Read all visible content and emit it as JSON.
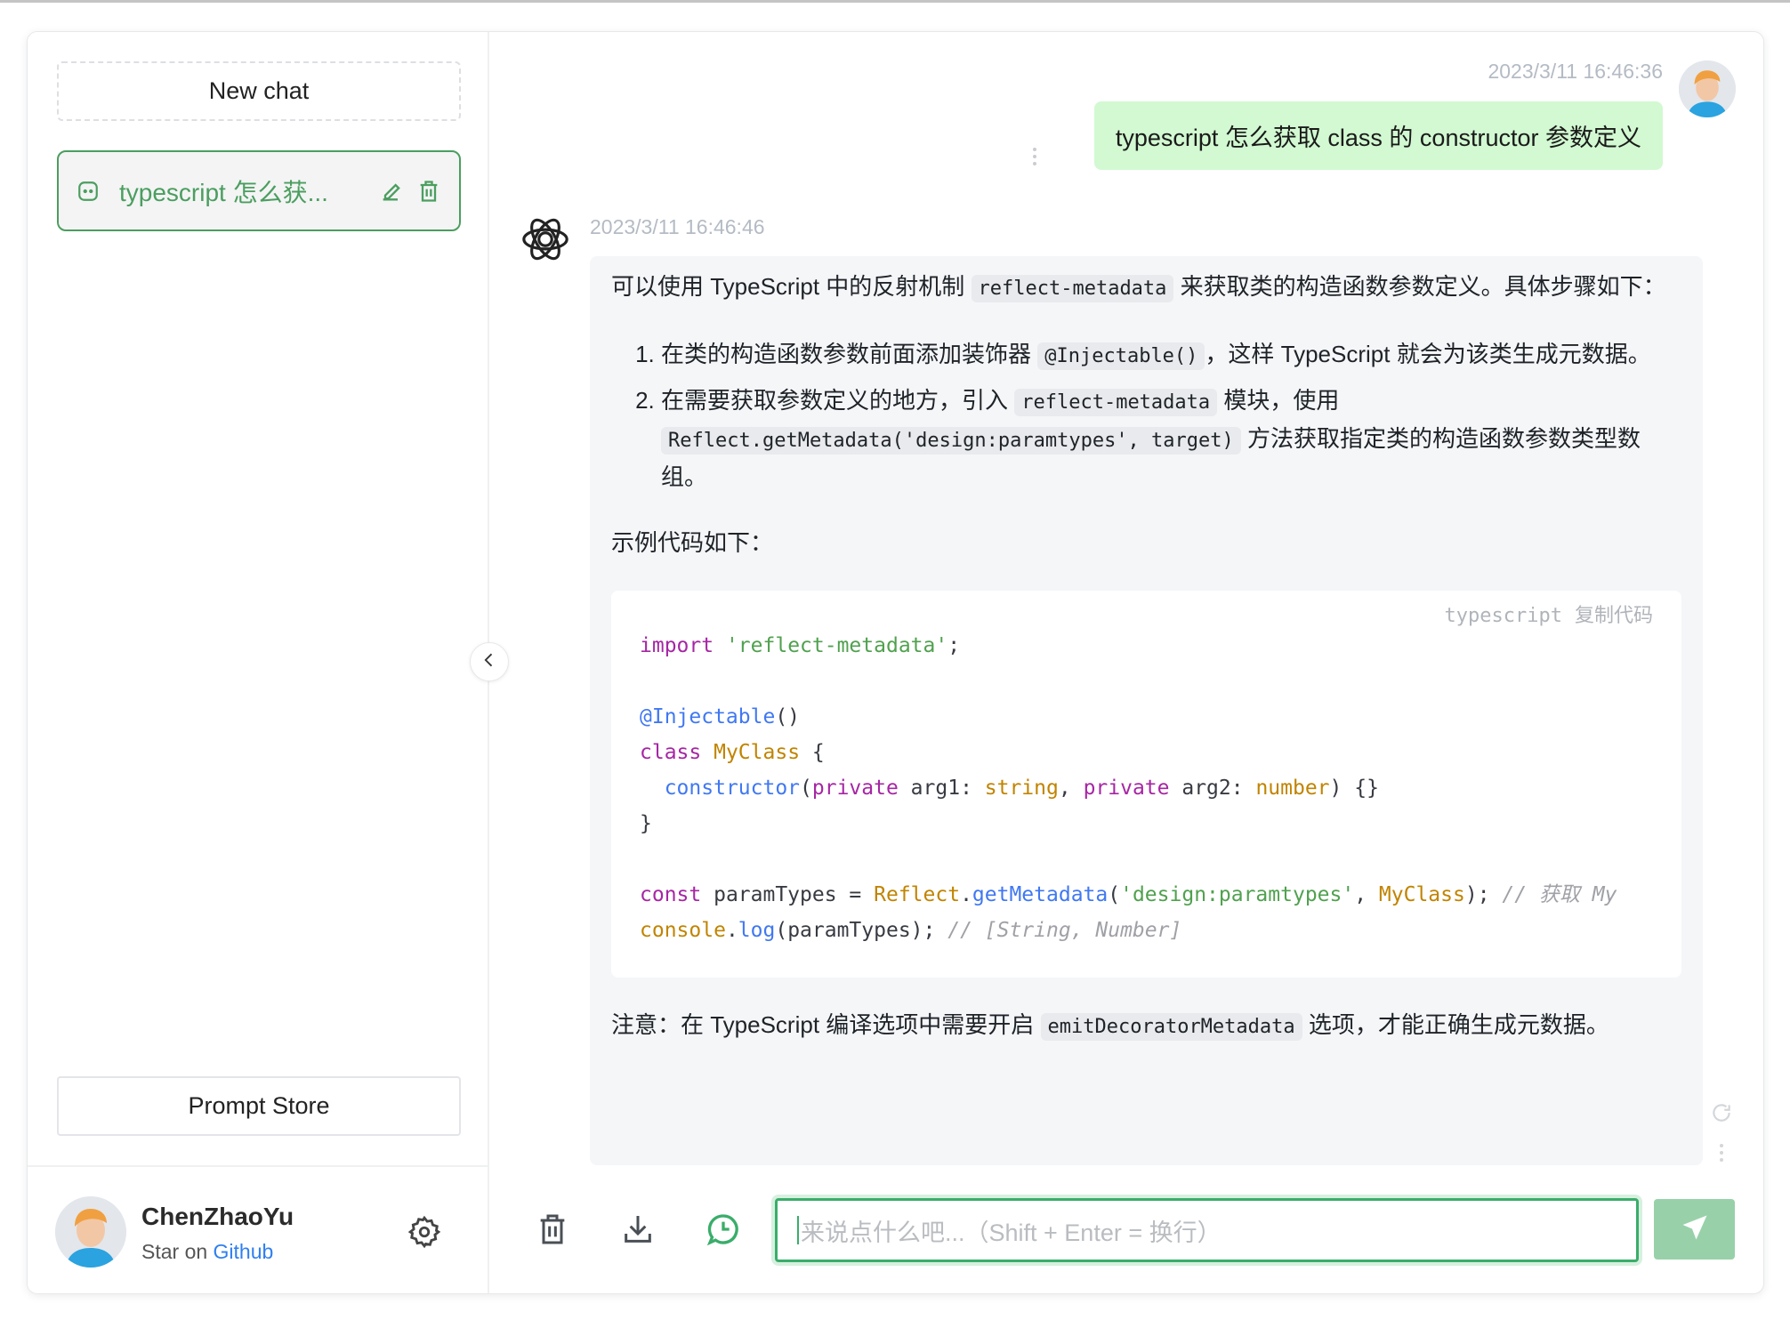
{
  "sidebar": {
    "new_chat": "New chat",
    "session": {
      "title": "typescript 怎么获...",
      "icon": "chat-bubble-icon"
    },
    "prompt_store": "Prompt Store",
    "user": {
      "name": "ChenZhaoYu",
      "star_prefix": "Star on",
      "star_link": "Github"
    }
  },
  "chat": {
    "user_message": {
      "timestamp": "2023/3/11 16:46:36",
      "text": "typescript 怎么获取 class 的 constructor 参数定义"
    },
    "bot_message": {
      "timestamp": "2023/3/11 16:46:46",
      "p1": [
        "可以使用 TypeScript 中的反射机制 ",
        "reflect-metadata",
        " 来获取类的构造函数参数定义。具体步骤如下："
      ],
      "list": [
        [
          "在类的构造函数参数前面添加装饰器 ",
          "@Injectable()",
          "，这样 TypeScript 就会为该类生成元数据。"
        ],
        [
          "在需要获取参数定义的地方，引入 ",
          "reflect-metadata",
          " 模块，使用 ",
          "Reflect.getMetadata('design:paramtypes', target)",
          " 方法获取指定类的构造函数参数类型数组。"
        ]
      ],
      "p2": "示例代码如下：",
      "code": {
        "language": "typescript",
        "copy_label": "复制代码",
        "lines": [
          [
            [
              "kw",
              "import"
            ],
            [
              "df",
              " "
            ],
            [
              "str",
              "'reflect-metadata'"
            ],
            [
              "df",
              ";"
            ]
          ],
          [],
          [
            [
              "fn",
              "@Injectable"
            ],
            [
              "df",
              "()"
            ]
          ],
          [
            [
              "kw",
              "class"
            ],
            [
              "df",
              " "
            ],
            [
              "ty",
              "MyClass"
            ],
            [
              "df",
              " {"
            ]
          ],
          [
            [
              "df",
              "  "
            ],
            [
              "fn",
              "constructor"
            ],
            [
              "df",
              "("
            ],
            [
              "kw",
              "private"
            ],
            [
              "df",
              " arg1: "
            ],
            [
              "ty",
              "string"
            ],
            [
              "df",
              ", "
            ],
            [
              "kw",
              "private"
            ],
            [
              "df",
              " arg2: "
            ],
            [
              "ty",
              "number"
            ],
            [
              "df",
              ") {}"
            ]
          ],
          [
            [
              "df",
              "}"
            ]
          ],
          [],
          [
            [
              "kw",
              "const"
            ],
            [
              "df",
              " paramTypes = "
            ],
            [
              "ty",
              "Reflect"
            ],
            [
              "df",
              "."
            ],
            [
              "fn",
              "getMetadata"
            ],
            [
              "df",
              "("
            ],
            [
              "str",
              "'design:paramtypes'"
            ],
            [
              "df",
              ", "
            ],
            [
              "ty",
              "MyClass"
            ],
            [
              "df",
              "); "
            ],
            [
              "cm",
              "// 获取 My"
            ]
          ],
          [
            [
              "ty",
              "console"
            ],
            [
              "df",
              "."
            ],
            [
              "fn",
              "log"
            ],
            [
              "df",
              "(paramTypes); "
            ],
            [
              "cm",
              "// [String, Number]"
            ]
          ]
        ]
      },
      "p3": [
        "注意：在 TypeScript 编译选项中需要开启 ",
        "emitDecoratorMetadata",
        " 选项，才能正确生成元数据。"
      ]
    }
  },
  "composer": {
    "placeholder": "来说点什么吧...（Shift + Enter = 换行）"
  },
  "colors": {
    "accent": "#4b9e5f",
    "user_bubble": "#d2f9d1",
    "send_button": "#98d1a9",
    "link": "#2f7ff0"
  }
}
